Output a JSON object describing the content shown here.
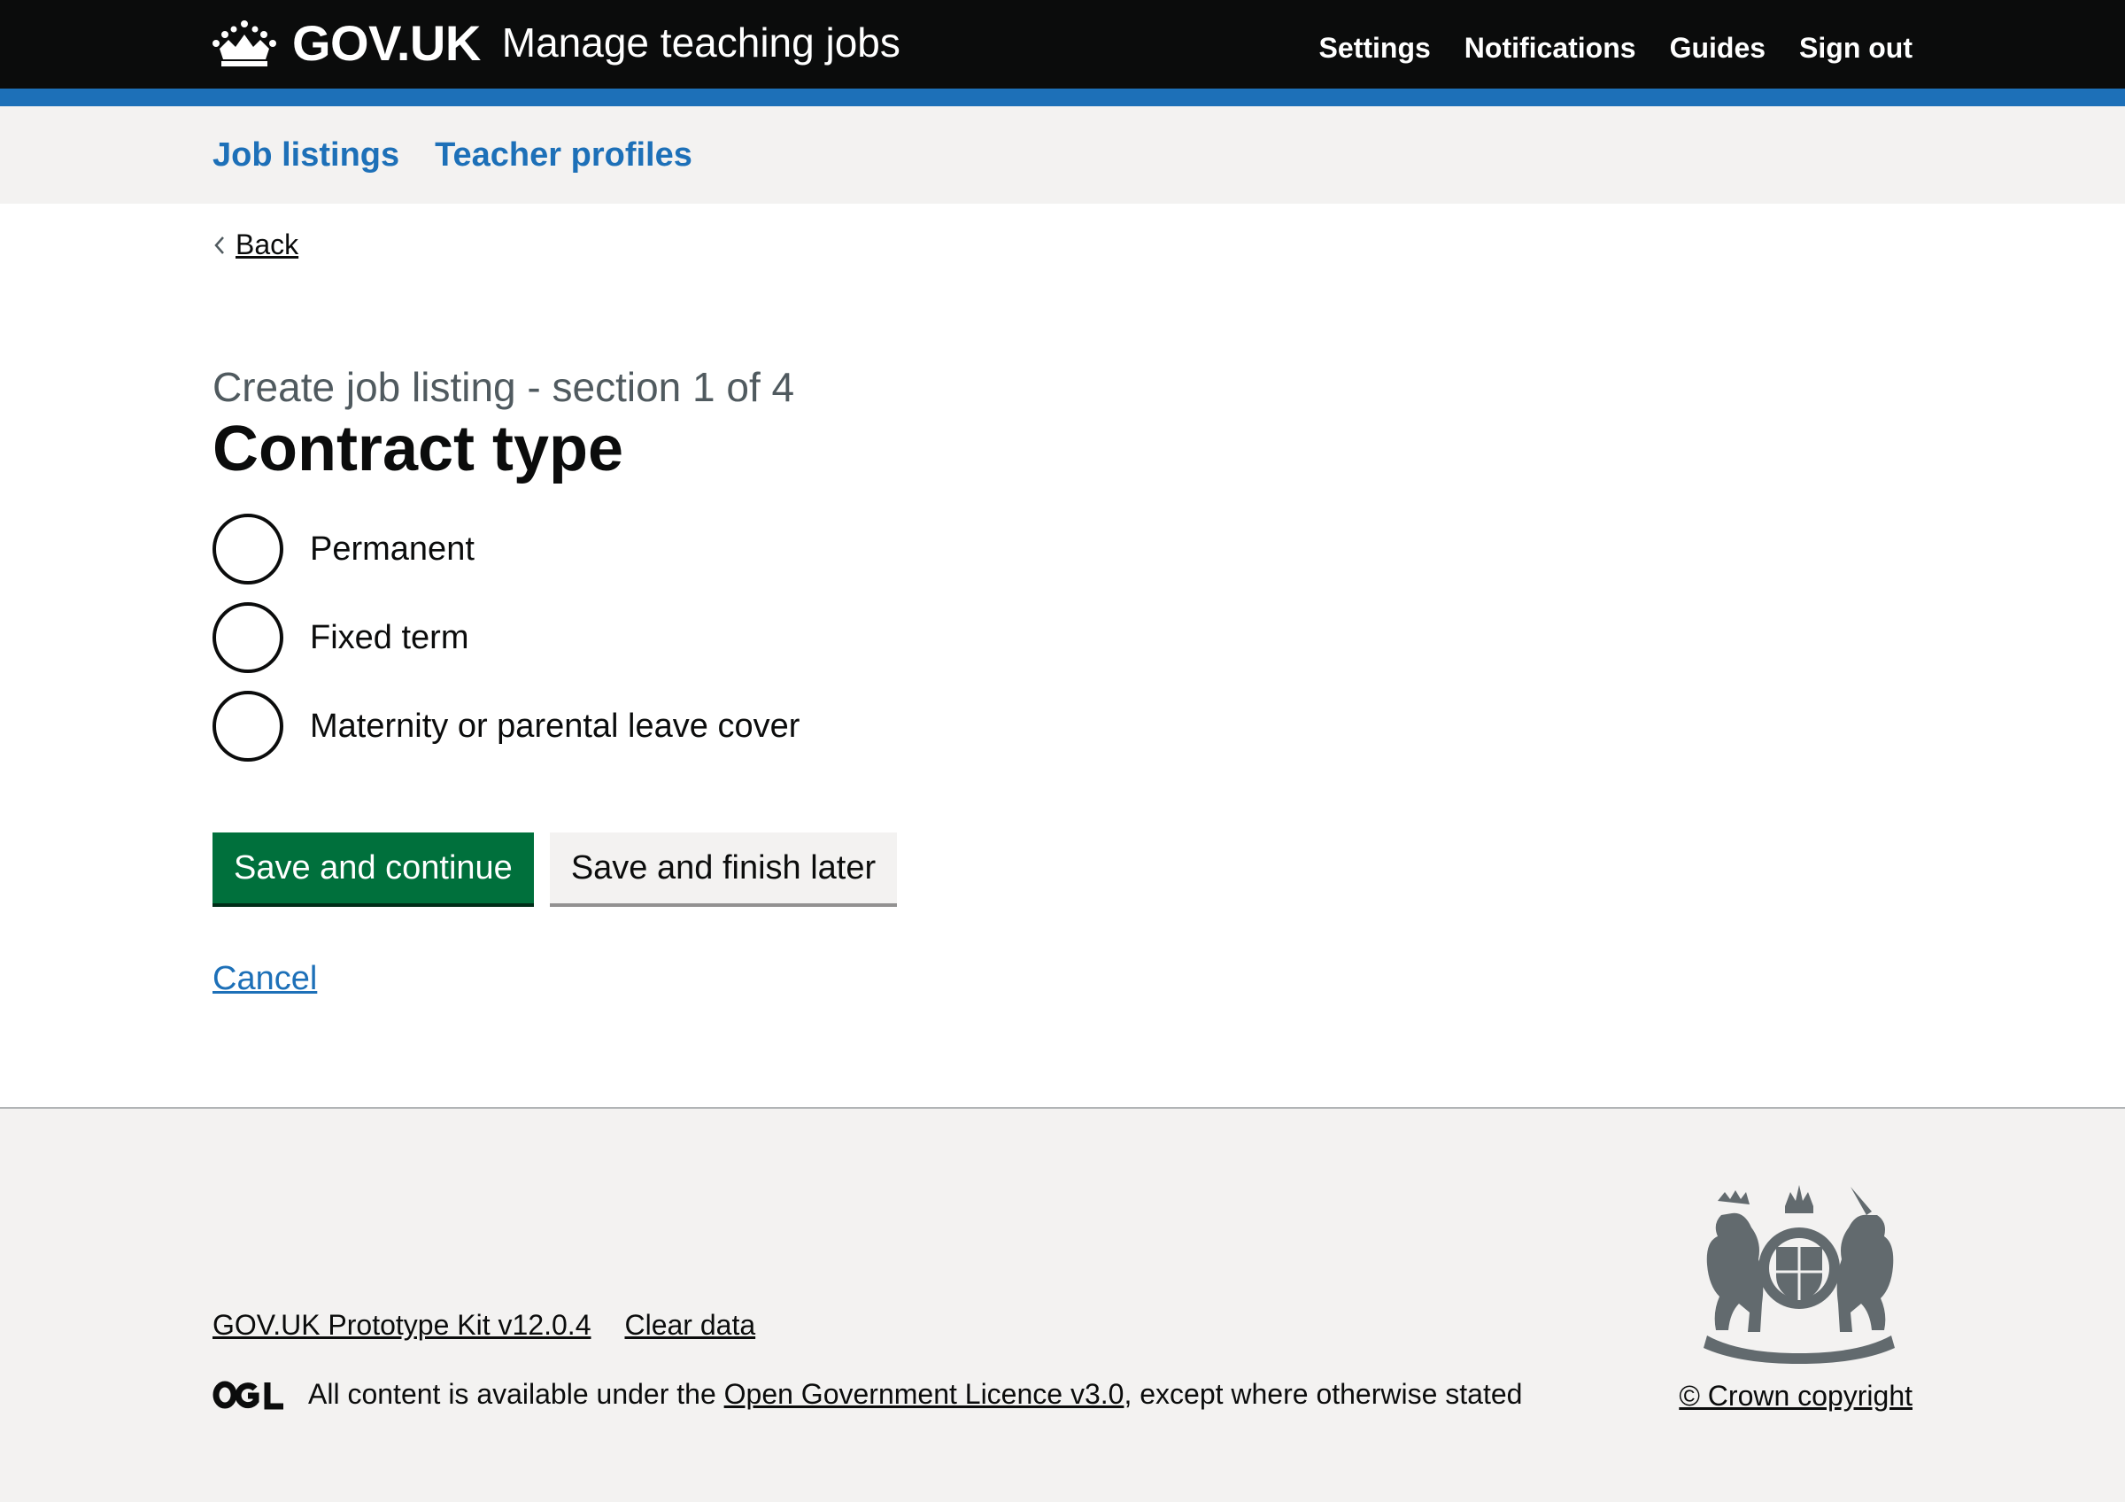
{
  "header": {
    "brand": "GOV.UK",
    "service_name": "Manage teaching jobs",
    "nav": [
      "Settings",
      "Notifications",
      "Guides",
      "Sign out"
    ]
  },
  "subnav": {
    "items": [
      "Job listings",
      "Teacher profiles"
    ]
  },
  "back": {
    "label": "Back"
  },
  "form": {
    "caption": "Create job listing - section 1 of 4",
    "title": "Contract type",
    "options": [
      "Permanent",
      "Fixed term",
      "Maternity or parental leave cover"
    ],
    "primary_button": "Save and continue",
    "secondary_button": "Save and finish later",
    "cancel": "Cancel"
  },
  "footer": {
    "links": [
      "GOV.UK Prototype Kit v12.0.4",
      "Clear data"
    ],
    "licence_prefix": "All content is available under the ",
    "licence_link": "Open Government Licence v3.0",
    "licence_suffix": ", except where otherwise stated",
    "copyright": "© Crown copyright"
  },
  "colors": {
    "header_bg": "#0b0c0c",
    "brand_blue": "#1d70b8",
    "primary_green": "#00703c",
    "light_grey": "#f3f2f1",
    "secondary_text": "#505a5f"
  },
  "icons": [
    "crown-icon",
    "back-chevron-icon",
    "ogl-logo-icon",
    "royal-coat-of-arms-icon"
  ]
}
